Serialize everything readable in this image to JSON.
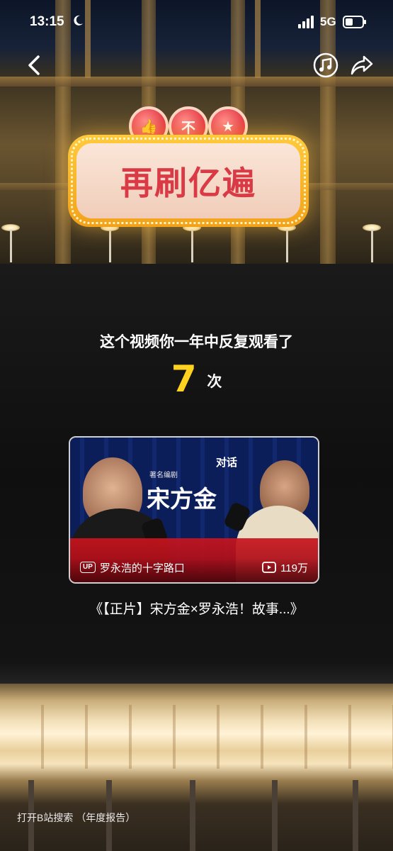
{
  "status_bar": {
    "time": "13:15",
    "network": "5G",
    "icons": [
      "moon-icon",
      "signal-icon",
      "battery-icon"
    ]
  },
  "nav": {
    "icons": [
      "back-icon",
      "music-icon",
      "share-icon"
    ]
  },
  "sign": {
    "text": "再刷亿遍",
    "badges": [
      "👍",
      "不",
      "★"
    ],
    "accent": "#d93a45",
    "frame": "#f5b325"
  },
  "report": {
    "headline": "这个视频你一年中反复观看了",
    "count": "7",
    "unit": "次",
    "count_color": "#ffd21f"
  },
  "video": {
    "thumbnail": {
      "kicker": "对话",
      "role": "著名编剧",
      "name": "宋方金"
    },
    "uploader": "罗永浩的十字路口",
    "views": "119万",
    "title": "《【正片】宋方金×罗永浩！故事...》"
  },
  "footer": {
    "hint": "打开B站搜索 （年度报告）"
  }
}
